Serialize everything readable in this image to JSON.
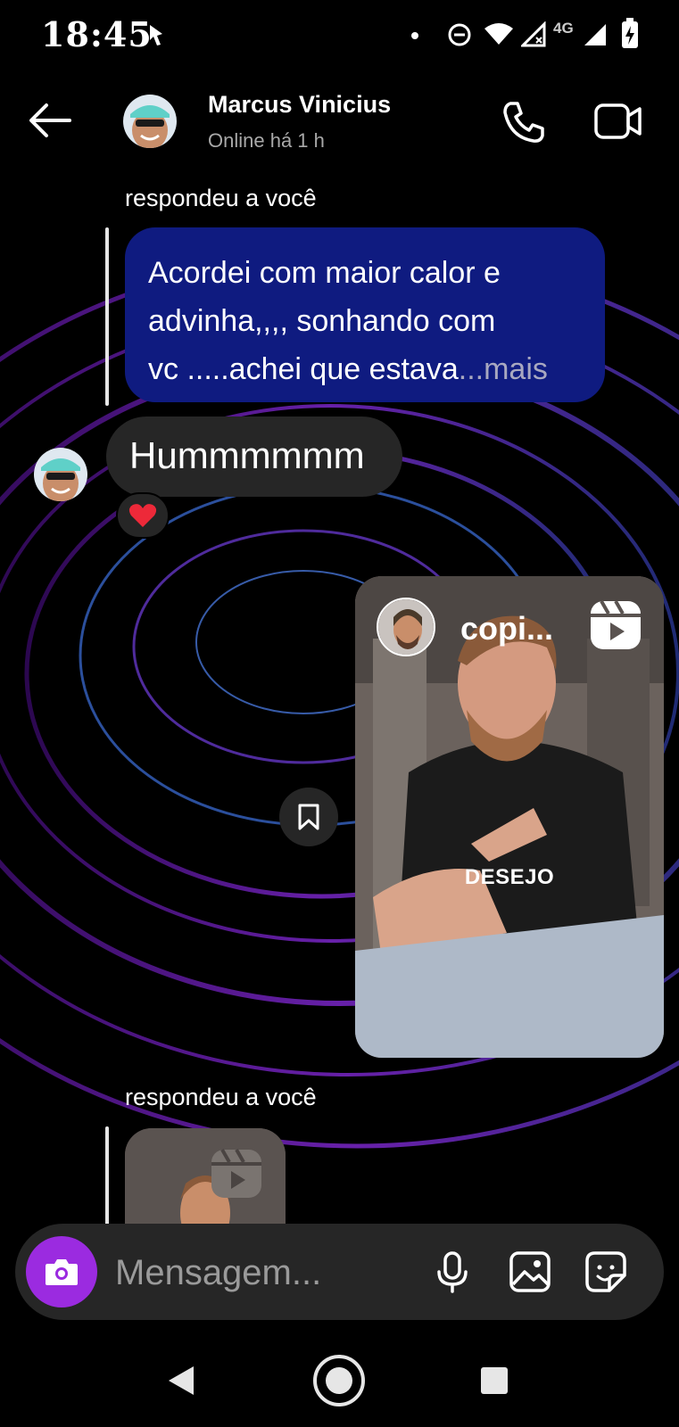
{
  "status_bar": {
    "time": "18:45",
    "network": "4G",
    "icons": [
      "location-pin-icon",
      "dot-icon",
      "do-not-disturb-icon",
      "wifi-icon",
      "signal-x-icon",
      "signal-icon",
      "battery-charging-icon"
    ]
  },
  "header": {
    "contact_name": "Marcus Vinicius",
    "presence": "Online há 1 h",
    "icons": [
      "back-arrow-icon",
      "phone-icon",
      "video-camera-icon"
    ]
  },
  "messages": [
    {
      "kind": "reply",
      "reply_label": "respondeu a você",
      "lines": [
        "Acordei com maior calor e",
        "advinha,,,, sonhando com",
        "vc .....achei que estava"
      ],
      "ellipsis": "...",
      "more_label": "mais",
      "bubble_color": "#0f1b80"
    },
    {
      "kind": "incoming",
      "text": "Hummmmmm",
      "reaction": "heart-icon",
      "bubble_color": "#262626"
    },
    {
      "kind": "shared_reel",
      "username": "copi...",
      "overlay_text": "DESEJO",
      "icons": [
        "reels-icon",
        "bookmark-icon"
      ]
    },
    {
      "kind": "reply_reel",
      "reply_label": "respondeu a você",
      "icons": [
        "reels-icon"
      ]
    }
  ],
  "composer": {
    "placeholder": "Mensagem...",
    "accent_color": "#9b2be0",
    "icons": [
      "camera-icon",
      "microphone-icon",
      "gallery-icon",
      "sticker-icon"
    ]
  },
  "nav_bar": {
    "icons": [
      "back-triangle-icon",
      "home-circle-icon",
      "recents-square-icon"
    ]
  }
}
